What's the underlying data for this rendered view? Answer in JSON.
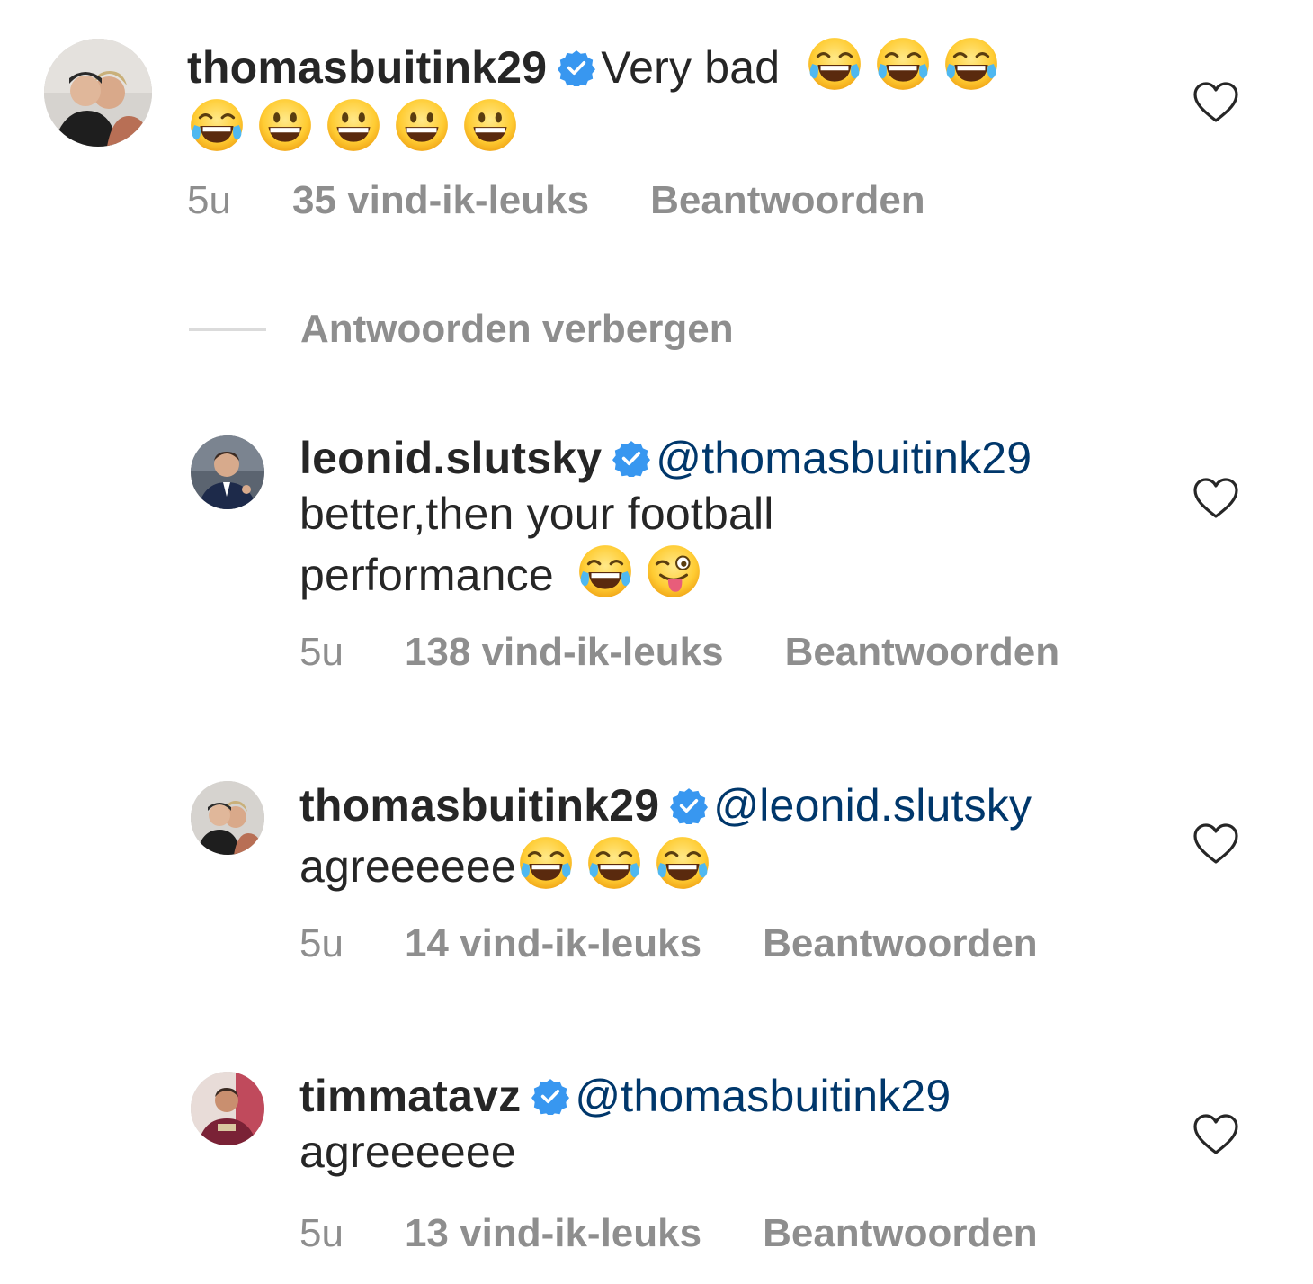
{
  "colors": {
    "text": "#262626",
    "secondary": "#8e8e8e",
    "mention": "#00376b",
    "verified": "#3897f0",
    "divider": "#dbdbdb"
  },
  "icons": {
    "verified": "verified-badge-icon",
    "like": "heart-outline-icon",
    "tears_of_joy": "face-with-tears-of-joy",
    "grinning": "grinning-face",
    "winking_tongue": "winking-face-with-tongue"
  },
  "main_comment": {
    "username": "thomasbuitink29",
    "text": "Very bad",
    "time": "5u",
    "likes": "35 vind-ik-leuks",
    "reply": "Beantwoorden"
  },
  "toggle_replies_label": "Antwoorden verbergen",
  "replies": [
    {
      "username": "leonid.slutsky",
      "mention": "@thomasbuitink29",
      "text_line1": "better,then your football",
      "text_line2": "performance",
      "time": "5u",
      "likes": "138 vind-ik-leuks",
      "reply": "Beantwoorden"
    },
    {
      "username": "thomasbuitink29",
      "mention": "@leonid.slutsky",
      "text": "agreeeeee",
      "time": "5u",
      "likes": "14 vind-ik-leuks",
      "reply": "Beantwoorden"
    },
    {
      "username": "timmatavz",
      "mention": "@thomasbuitink29",
      "text": "agreeeeee",
      "time": "5u",
      "likes": "13 vind-ik-leuks",
      "reply": "Beantwoorden"
    }
  ]
}
